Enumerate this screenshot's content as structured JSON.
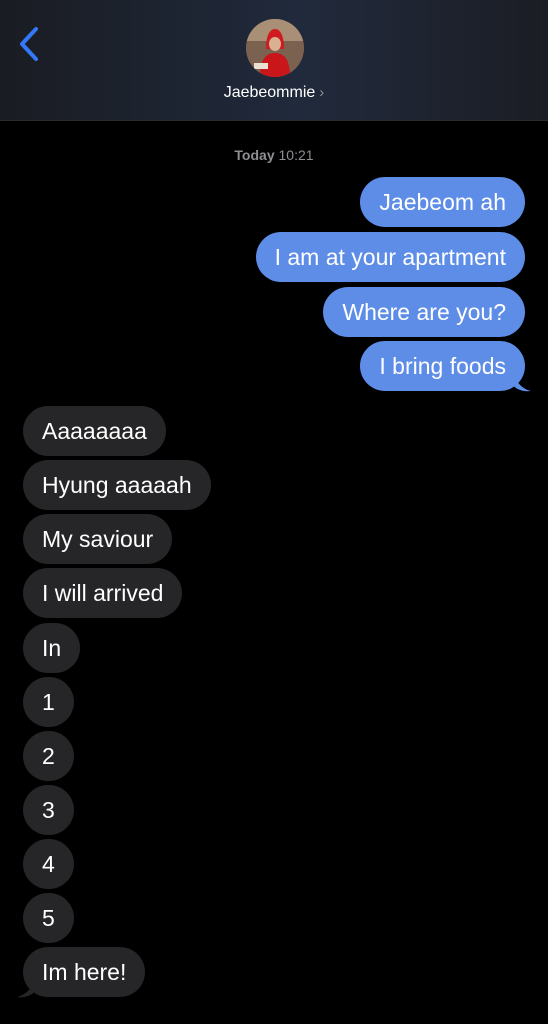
{
  "header": {
    "contact_name": "Jaebeommie",
    "back_icon": "chevron-left-icon",
    "chevron": "›"
  },
  "timestamp": {
    "day": "Today",
    "time": "10:21"
  },
  "colors": {
    "sent": "#5e8de8",
    "received": "#262628",
    "accent": "#3478f6"
  },
  "sent": [
    "Jaebeom ah",
    "I am at your apartment",
    "Where are you?",
    "I bring foods"
  ],
  "received": [
    "Aaaaaaaa",
    "Hyung aaaaah",
    "My saviour",
    "I will arrived",
    "In",
    "1",
    "2",
    "3",
    "4",
    "5",
    "Im here!"
  ]
}
